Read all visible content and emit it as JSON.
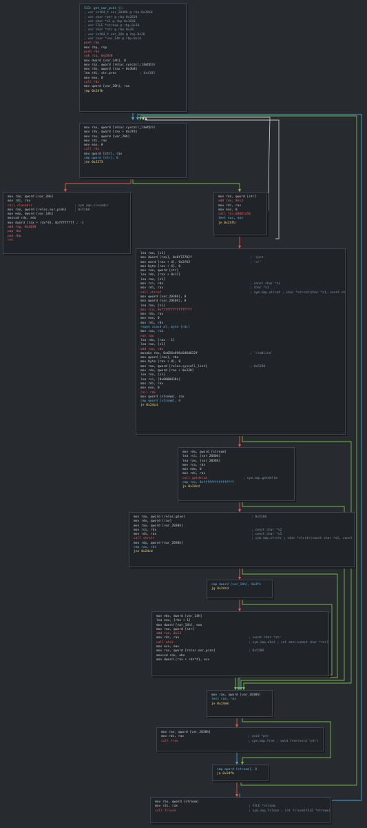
{
  "blocks": [
    {
      "id": "b0",
      "lines": [
        {
          "t": "533: get_our_pids ();",
          "c": "k-label"
        },
        {
          "t": "; var int64_t var_2040h @ rbp-0x2040",
          "c": "k-comment"
        },
        {
          "t": "; var char *ptr @ rbp-0x2038",
          "c": "k-comment"
        },
        {
          "t": "; var char *s1 @ rbp-0x1030",
          "c": "k-comment"
        },
        {
          "t": "; var FILE *stream @ rbp-0x30",
          "c": "k-comment"
        },
        {
          "t": "; var char *str @ rbp-0x28",
          "c": "k-comment"
        },
        {
          "t": "; var int64_t var_20h @ rbp-0x20",
          "c": "k-comment"
        },
        {
          "t": "; var char *var_14h @ rbp-0x14",
          "c": "k-comment"
        },
        {
          "t": "push rbp",
          "c": "k-arith"
        },
        {
          "t": "mov rbp, rsp",
          "c": "k-normal"
        },
        {
          "t": "push rbx",
          "c": "k-arith"
        },
        {
          "t": "sub rsp, 0x2038",
          "c": "k-arith"
        },
        {
          "t": "mov dword [var_14h], 0",
          "c": "k-normal"
        },
        {
          "t": "mov rax, qword [reloc.syscall_list]",
          "c": "k-normal",
          "cm": "; 0x5288"
        },
        {
          "t": "mov rdx, qword [rax + 0x3b8]",
          "c": "k-normal"
        },
        {
          "t": "lea rdi, str.proc",
          "c": "k-normal",
          "cm": "; 0x4385"
        },
        {
          "t": "mov eax, 0",
          "c": "k-normal"
        },
        {
          "t": "call rdx",
          "c": "k-call"
        },
        {
          "t": "mov qword [var_20h], rax",
          "c": "k-normal"
        },
        {
          "t": "jmp 0x24fb",
          "c": "k-jump"
        }
      ]
    },
    {
      "id": "b1",
      "lines": [
        {
          "t": "mov rax, qword [reloc.syscall_list]",
          "c": "k-normal",
          "cm": "; 0x5288"
        },
        {
          "t": "mov rdx, qword [rax + 0x3f8]",
          "c": "k-normal"
        },
        {
          "t": "mov rax, qword [var_20h]",
          "c": "k-normal"
        },
        {
          "t": "mov rdi, rax",
          "c": "k-normal"
        },
        {
          "t": "mov eax, 0",
          "c": "k-normal"
        },
        {
          "t": "call rdx",
          "c": "k-call"
        },
        {
          "t": "mov qword [str], rax",
          "c": "k-normal"
        },
        {
          "t": "cmp qword [str], 0",
          "c": "k-cmp"
        },
        {
          "t": "jne 0x2373",
          "c": "k-jump"
        }
      ]
    },
    {
      "id": "b2",
      "lines": [
        {
          "t": "mov rax, qword [var_20h]",
          "c": "k-normal"
        },
        {
          "t": "mov rdi, rax",
          "c": "k-normal"
        },
        {
          "t": "call closedir",
          "c": "k-call",
          "cm": "; sym.imp.closedir"
        },
        {
          "t": "mov rax, qword [reloc.our_pids]",
          "c": "k-normal",
          "cm": "; 0x5288"
        },
        {
          "t": "mov edx, dword [var_14h]",
          "c": "k-normal"
        },
        {
          "t": "movsxd rdx, edx",
          "c": "k-normal"
        },
        {
          "t": "mov dword [rax + rdx*4], 0xffffffff ; -1",
          "c": "k-normal"
        },
        {
          "t": "add rsp, 0x2038",
          "c": "k-arith"
        },
        {
          "t": "pop rbx",
          "c": "k-arith"
        },
        {
          "t": "pop rbp",
          "c": "k-arith"
        },
        {
          "t": "ret",
          "c": "k-call"
        }
      ]
    },
    {
      "id": "b3",
      "lines": [
        {
          "t": "mov rax, qword [str]",
          "c": "k-normal"
        },
        {
          "t": "add rax, 0x13",
          "c": "k-arith"
        },
        {
          "t": "mov rdi, rax",
          "c": "k-normal"
        },
        {
          "t": "mov eax, 0",
          "c": "k-normal"
        },
        {
          "t": "call fcn.00001a50",
          "c": "k-call"
        },
        {
          "t": "test eax, eax",
          "c": "k-cmp"
        },
        {
          "t": "je 0x24fb",
          "c": "k-jump"
        }
      ]
    },
    {
      "id": "b4",
      "lines": [
        {
          "t": "lea rax, [s1]",
          "c": "k-normal"
        },
        {
          "t": "mov dword [rax], 0x6f72702f",
          "c": "k-normal",
          "cm": "; '/pro'"
        },
        {
          "t": "mov word [rax + 4], 0x2f63",
          "c": "k-normal",
          "cm": "; 'c/'"
        },
        {
          "t": "mov byte [rax + 6], 0",
          "c": "k-normal"
        },
        {
          "t": "mov rax, qword [str]",
          "c": "k-normal"
        },
        {
          "t": "lea rdx, [rax + 0x13]",
          "c": "k-normal"
        },
        {
          "t": "lea rax, [s1]",
          "c": "k-normal"
        },
        {
          "t": "mov rsi, rdx",
          "c": "k-normal",
          "cm": "; const char *s2"
        },
        {
          "t": "mov rdi, rax",
          "c": "k-normal",
          "cm": "; char *s1"
        },
        {
          "t": "call strcat",
          "c": "k-call",
          "cm": "; sym.imp.strcat ; char *strcat(char *s1, const char *s2)"
        },
        {
          "t": "mov qword [var_2038h], 0",
          "c": "k-normal"
        },
        {
          "t": "mov qword [var_2040h], 0",
          "c": "k-normal"
        },
        {
          "t": "lea rax, [s1]",
          "c": "k-normal"
        },
        {
          "t": "mov rcx, 0xffffffffffffffff",
          "c": "k-arith"
        },
        {
          "t": "mov rdx, rax",
          "c": "k-normal"
        },
        {
          "t": "mov eax, 0",
          "c": "k-normal"
        },
        {
          "t": "mov rdi, rdx",
          "c": "k-normal"
        },
        {
          "t": "repne scasb al, byte [rdi]",
          "c": "k-cmp"
        },
        {
          "t": "mov rax, rcx",
          "c": "k-normal"
        },
        {
          "t": "not rax",
          "c": "k-arith"
        },
        {
          "t": "lea rdx, [rax - 1]",
          "c": "k-normal"
        },
        {
          "t": "lea rax, [s1]",
          "c": "k-normal"
        },
        {
          "t": "add rax, rdx",
          "c": "k-arith"
        },
        {
          "t": "movabs rbx, 0x656e696c646d632f",
          "c": "k-normal",
          "cm": "; '/cmdline'"
        },
        {
          "t": "mov qword [rax], rbx",
          "c": "k-normal"
        },
        {
          "t": "mov byte [rax + 8], 0",
          "c": "k-normal"
        },
        {
          "t": "mov rax, qword [reloc.syscall_list]",
          "c": "k-normal",
          "cm": "; 0x5288"
        },
        {
          "t": "mov rdx, qword [rax + 0x338]",
          "c": "k-normal"
        },
        {
          "t": "lea rax, [s1]",
          "c": "k-normal"
        },
        {
          "t": "lea rsi, [0x0000438c]",
          "c": "k-normal"
        },
        {
          "t": "mov rdi, rax",
          "c": "k-normal"
        },
        {
          "t": "mov eax, 0",
          "c": "k-normal"
        },
        {
          "t": "call rdx",
          "c": "k-call"
        },
        {
          "t": "mov qword [stream], rax",
          "c": "k-normal"
        },
        {
          "t": "cmp qword [stream], 0",
          "c": "k-cmp"
        },
        {
          "t": "je 0x24cd",
          "c": "k-jump"
        }
      ]
    },
    {
      "id": "b5",
      "lines": [
        {
          "t": "mov rdx, qword [stream]",
          "c": "k-normal"
        },
        {
          "t": "lea rsi, [var_2040h]",
          "c": "k-normal"
        },
        {
          "t": "lea rax, [var_2038h]",
          "c": "k-normal"
        },
        {
          "t": "mov rcx, rdx",
          "c": "k-normal"
        },
        {
          "t": "mov edx, 0",
          "c": "k-normal"
        },
        {
          "t": "mov rdi, rax",
          "c": "k-normal"
        },
        {
          "t": "call getdelim",
          "c": "k-call",
          "cm": "; sym.imp.getdelim"
        },
        {
          "t": "cmp rax, 0xffffffffffffffff",
          "c": "k-cmp"
        },
        {
          "t": "je 0x24cd",
          "c": "k-jump"
        }
      ]
    },
    {
      "id": "b6",
      "lines": [
        {
          "t": "mov rax, qword [reloc.gExe]",
          "c": "k-normal",
          "cm": "; 0x5200"
        },
        {
          "t": "mov rdx, qword [rax]",
          "c": "k-normal"
        },
        {
          "t": "mov rax, qword [var_2038h]",
          "c": "k-normal"
        },
        {
          "t": "mov rsi, rdx",
          "c": "k-normal",
          "cm": "; const char *s2"
        },
        {
          "t": "mov rdi, rax",
          "c": "k-normal",
          "cm": "; const char *s1"
        },
        {
          "t": "call strstr",
          "c": "k-call",
          "cm": "; sym.imp.strstr ; char *strstr(const char *s1, const char *s2)"
        },
        {
          "t": "mov rdx, qword [var_2038h]",
          "c": "k-normal"
        },
        {
          "t": "cmp rax, rdx",
          "c": "k-cmp"
        },
        {
          "t": "jne 0x24cd",
          "c": "k-jump"
        }
      ]
    },
    {
      "id": "b7",
      "lines": [
        {
          "t": "cmp dword [var_14h], 0x3fe",
          "c": "k-cmp"
        },
        {
          "t": "jg 0x24cd",
          "c": "k-jump"
        }
      ]
    },
    {
      "id": "b8",
      "lines": [
        {
          "t": "mov ebx, dword [var_14h]",
          "c": "k-normal"
        },
        {
          "t": "lea eax, [rbx + 1]",
          "c": "k-normal"
        },
        {
          "t": "mov dword [var_14h], eax",
          "c": "k-normal"
        },
        {
          "t": "mov rax, qword [str]",
          "c": "k-normal"
        },
        {
          "t": "add rax, 0x13",
          "c": "k-arith"
        },
        {
          "t": "mov rdi, rax",
          "c": "k-normal",
          "cm": "; const char *str"
        },
        {
          "t": "call atoi",
          "c": "k-call",
          "cm": "; sym.imp.atoi ; int atoi(const char *str)"
        },
        {
          "t": "mov ecx, eax",
          "c": "k-normal"
        },
        {
          "t": "mov rax, qword [reloc.our_pids]",
          "c": "k-normal",
          "cm": "; 0x5288"
        },
        {
          "t": "movsxd rdx, ebx",
          "c": "k-normal"
        },
        {
          "t": "mov dword [rax + rdx*4], ecx",
          "c": "k-normal"
        }
      ]
    },
    {
      "id": "b9",
      "lines": [
        {
          "t": "mov rax, qword [var_2038h]",
          "c": "k-normal"
        },
        {
          "t": "test rax, rax",
          "c": "k-cmp"
        },
        {
          "t": "je 0x24e8",
          "c": "k-jump"
        }
      ]
    },
    {
      "id": "b10",
      "lines": [
        {
          "t": "mov rax, qword [var_2038h]",
          "c": "k-normal"
        },
        {
          "t": "mov rdi, rax",
          "c": "k-normal",
          "cm": "; void *ptr"
        },
        {
          "t": "call free",
          "c": "k-call",
          "cm": "; sym.imp.free ; void free(void *ptr)"
        }
      ]
    },
    {
      "id": "b11",
      "lines": [
        {
          "t": "cmp qword [stream], 0",
          "c": "k-cmp"
        },
        {
          "t": "je 0x24fb",
          "c": "k-jump"
        }
      ]
    },
    {
      "id": "b12",
      "lines": [
        {
          "t": "mov rax, qword [stream]",
          "c": "k-normal"
        },
        {
          "t": "mov rdi, rax",
          "c": "k-normal",
          "cm": "; FILE *stream"
        },
        {
          "t": "call fclose",
          "c": "k-call",
          "cm": "; sym.imp.fclose ; int fclose(FILE *stream)"
        }
      ]
    }
  ]
}
